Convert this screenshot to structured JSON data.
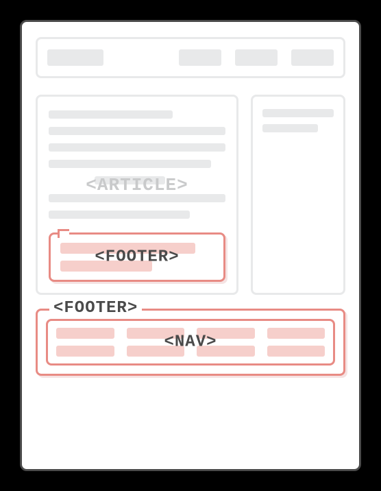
{
  "labels": {
    "article": "<ARTICLE>",
    "article_footer": "<FOOTER>",
    "page_footer": "<FOOTER>",
    "nav": "<NAV>"
  }
}
